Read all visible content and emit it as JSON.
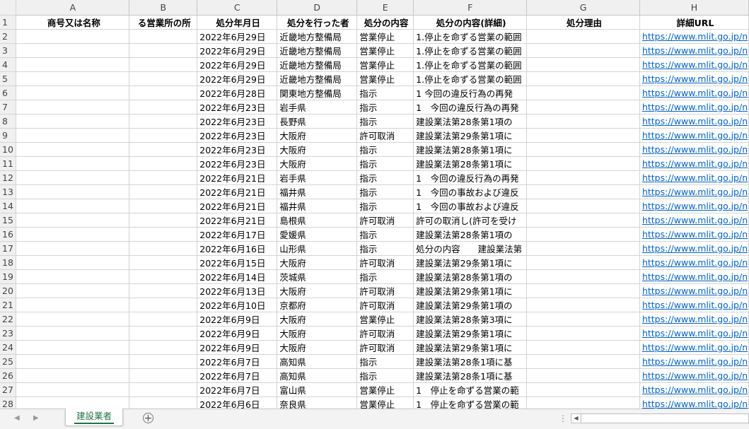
{
  "columns": [
    "A",
    "B",
    "C",
    "D",
    "E",
    "F",
    "G",
    "H"
  ],
  "header": {
    "row_number": "1",
    "cells": [
      "商号又は名称",
      "る営業所の所",
      "処分年月日",
      "処分を行った者",
      "処分の内容",
      "処分の内容(詳細)",
      "処分理由",
      "詳細URL"
    ]
  },
  "rows": [
    {
      "num": "2",
      "date": "2022年6月29日",
      "authority": "近畿地方整備局",
      "type": "営業停止",
      "detail": "1.停止を命ずる営業の範囲",
      "url": "https://www.mlit.go.jp/n"
    },
    {
      "num": "3",
      "date": "2022年6月29日",
      "authority": "近畿地方整備局",
      "type": "営業停止",
      "detail": "1.停止を命ずる営業の範囲",
      "url": "https://www.mlit.go.jp/n"
    },
    {
      "num": "4",
      "date": "2022年6月29日",
      "authority": "近畿地方整備局",
      "type": "営業停止",
      "detail": "1.停止を命ずる営業の範囲",
      "url": "https://www.mlit.go.jp/n"
    },
    {
      "num": "5",
      "date": "2022年6月29日",
      "authority": "近畿地方整備局",
      "type": "営業停止",
      "detail": "1.停止を命ずる営業の範囲",
      "url": "https://www.mlit.go.jp/n"
    },
    {
      "num": "6",
      "date": "2022年6月28日",
      "authority": "関東地方整備局",
      "type": "指示",
      "detail": "1 今回の違反行為の再発",
      "url": "https://www.mlit.go.jp/n"
    },
    {
      "num": "7",
      "date": "2022年6月23日",
      "authority": "岩手県",
      "type": "指示",
      "detail": "1　今回の違反行為の再発",
      "url": "https://www.mlit.go.jp/n"
    },
    {
      "num": "8",
      "date": "2022年6月23日",
      "authority": "長野県",
      "type": "指示",
      "detail": "建設業法第28条第1項の",
      "url": "https://www.mlit.go.jp/n"
    },
    {
      "num": "9",
      "date": "2022年6月23日",
      "authority": "大阪府",
      "type": "許可取消",
      "detail": "建設業法第29条第1項に",
      "url": "https://www.mlit.go.jp/n"
    },
    {
      "num": "10",
      "date": "2022年6月23日",
      "authority": "大阪府",
      "type": "指示",
      "detail": "建設業法第28条第1項に",
      "url": "https://www.mlit.go.jp/n"
    },
    {
      "num": "11",
      "date": "2022年6月23日",
      "authority": "大阪府",
      "type": "指示",
      "detail": "建設業法第28条第1項に",
      "url": "https://www.mlit.go.jp/n"
    },
    {
      "num": "12",
      "date": "2022年6月21日",
      "authority": "岩手県",
      "type": "指示",
      "detail": "1　今回の違反行為の再発",
      "url": "https://www.mlit.go.jp/n"
    },
    {
      "num": "13",
      "date": "2022年6月21日",
      "authority": "福井県",
      "type": "指示",
      "detail": "1　今回の事故および違反",
      "url": "https://www.mlit.go.jp/n"
    },
    {
      "num": "14",
      "date": "2022年6月21日",
      "authority": "福井県",
      "type": "指示",
      "detail": "1　今回の事故および違反",
      "url": "https://www.mlit.go.jp/n"
    },
    {
      "num": "15",
      "date": "2022年6月21日",
      "authority": "島根県",
      "type": "許可取消",
      "detail": "許可の取消し(許可を受け",
      "url": "https://www.mlit.go.jp/n"
    },
    {
      "num": "16",
      "date": "2022年6月17日",
      "authority": "愛媛県",
      "type": "指示",
      "detail": "建設業法第28条第1項の",
      "url": "https://www.mlit.go.jp/n"
    },
    {
      "num": "17",
      "date": "2022年6月16日",
      "authority": "山形県",
      "type": "指示",
      "detail": "処分の内容　　建設業法第",
      "url": "https://www.mlit.go.jp/n"
    },
    {
      "num": "18",
      "date": "2022年6月15日",
      "authority": "大阪府",
      "type": "許可取消",
      "detail": "建設業法第29条第1項に",
      "url": "https://www.mlit.go.jp/n"
    },
    {
      "num": "19",
      "date": "2022年6月14日",
      "authority": "茨城県",
      "type": "指示",
      "detail": "建設業法第28条第1項の",
      "url": "https://www.mlit.go.jp/n"
    },
    {
      "num": "20",
      "date": "2022年6月13日",
      "authority": "大阪府",
      "type": "許可取消",
      "detail": "建設業法第29条第1項に",
      "url": "https://www.mlit.go.jp/n"
    },
    {
      "num": "21",
      "date": "2022年6月10日",
      "authority": "京都府",
      "type": "許可取消",
      "detail": "建設業法第29条第1項の",
      "url": "https://www.mlit.go.jp/n"
    },
    {
      "num": "22",
      "date": "2022年6月9日",
      "authority": "大阪府",
      "type": "営業停止",
      "detail": "建設業法第28条第3項に",
      "url": "https://www.mlit.go.jp/n"
    },
    {
      "num": "23",
      "date": "2022年6月9日",
      "authority": "大阪府",
      "type": "許可取消",
      "detail": "建設業法第29条第1項に",
      "url": "https://www.mlit.go.jp/n"
    },
    {
      "num": "24",
      "date": "2022年6月9日",
      "authority": "大阪府",
      "type": "許可取消",
      "detail": "建設業法第29条第1項に",
      "url": "https://www.mlit.go.jp/n"
    },
    {
      "num": "25",
      "date": "2022年6月7日",
      "authority": "高知県",
      "type": "指示",
      "detail": "建設業法第28条1項に基",
      "url": "https://www.mlit.go.jp/n"
    },
    {
      "num": "26",
      "date": "2022年6月7日",
      "authority": "高知県",
      "type": "指示",
      "detail": "建設業法第28条1項に基",
      "url": "https://www.mlit.go.jp/n"
    },
    {
      "num": "27",
      "date": "2022年6月7日",
      "authority": "富山県",
      "type": "営業停止",
      "detail": "1　停止を命ずる営業の範",
      "url": "https://www.mlit.go.jp/n"
    },
    {
      "num": "28",
      "date": "2022年6月6日",
      "authority": "奈良県",
      "type": "営業停止",
      "detail": "1　停止を命ずる営業の範",
      "url": "https://www.mlit.go.jp/n"
    }
  ],
  "sheet_tab": {
    "label": "建設業者"
  },
  "icons": {
    "prev": "chevron-left-icon",
    "next": "chevron-right-icon",
    "add": "plus-circle-icon"
  },
  "colors": {
    "tab_accent": "#217346",
    "link": "#0563c1"
  }
}
